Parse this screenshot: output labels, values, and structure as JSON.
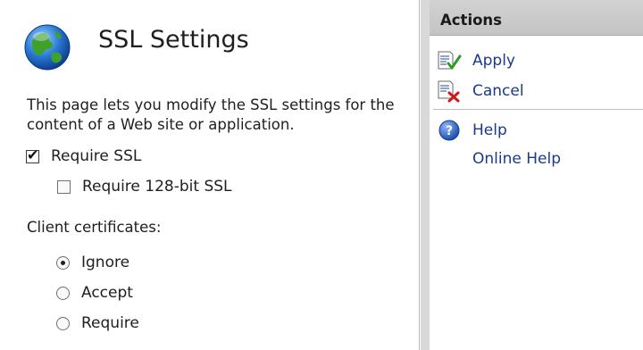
{
  "page": {
    "title": "SSL Settings",
    "description": "This page lets you modify the SSL settings for the content of a Web site or application."
  },
  "ssl": {
    "require_ssl": {
      "label": "Require SSL",
      "checked": true
    },
    "require_128bit": {
      "label": "Require 128-bit SSL",
      "checked": false
    }
  },
  "client_certificates": {
    "label": "Client certificates:",
    "options": [
      {
        "label": "Ignore",
        "selected": true
      },
      {
        "label": "Accept",
        "selected": false
      },
      {
        "label": "Require",
        "selected": false
      }
    ]
  },
  "actions": {
    "header": "Actions",
    "apply": "Apply",
    "cancel": "Cancel",
    "help": "Help",
    "online_help": "Online Help"
  },
  "icons": {
    "globe": "globe-icon",
    "apply": "apply-icon",
    "cancel": "cancel-icon",
    "help": "help-icon"
  },
  "colors": {
    "link": "#1a3a8a",
    "apply_check": "#2e9a2e",
    "cancel_x": "#d01818",
    "help_blue": "#2a5cb8"
  }
}
